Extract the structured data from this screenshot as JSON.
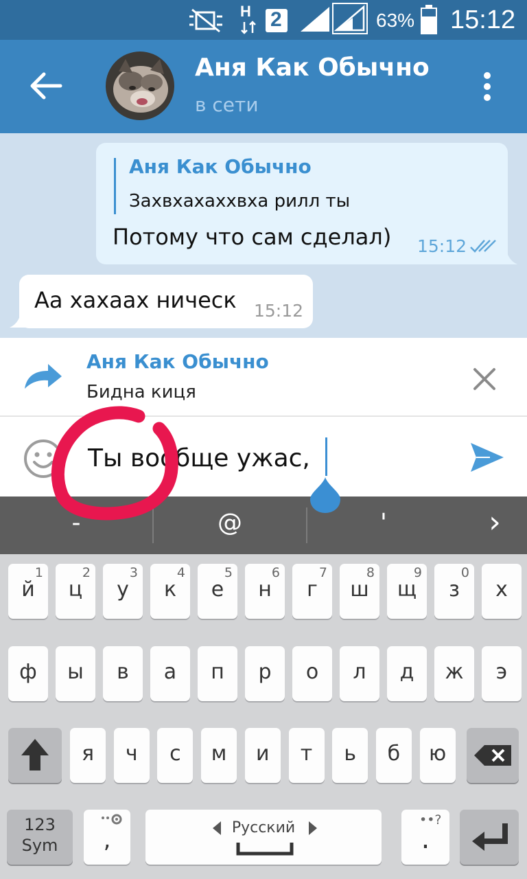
{
  "status_bar": {
    "network_h": "H",
    "sim_slot": "2",
    "battery_percent": "63%",
    "time": "15:12",
    "icons": [
      "mute-vibrate-icon",
      "data-arrows-icon",
      "signal-icon",
      "signal-icon-2",
      "battery-icon"
    ]
  },
  "header": {
    "contact_name": "Аня Как Обычно",
    "status": "в сети",
    "icons": [
      "back-arrow-icon",
      "avatar",
      "more-vert-icon"
    ]
  },
  "messages": [
    {
      "direction": "out",
      "reply_to_name": "Аня Как Обычно",
      "reply_to_text": "Захвхахаххвха рилл ты",
      "text": "Потому что сам сделал)",
      "time": "15:12",
      "read_icon": "double-check-icon"
    },
    {
      "direction": "in",
      "text": "Аа хахаах ническ",
      "time": "15:12"
    }
  ],
  "forward_panel": {
    "name": "Аня Как Обычно",
    "text": "Бидна киця",
    "icons": [
      "forward-arrow-icon",
      "close-icon"
    ]
  },
  "input": {
    "value": "Ты вообще ужас,",
    "icons": [
      "emoji-icon",
      "send-icon"
    ]
  },
  "suggestions": [
    "-",
    "@",
    "'",
    "›"
  ],
  "keyboard": {
    "row1": [
      {
        "label": "й",
        "hint": "1"
      },
      {
        "label": "ц",
        "hint": "2"
      },
      {
        "label": "у",
        "hint": "3"
      },
      {
        "label": "к",
        "hint": "4"
      },
      {
        "label": "е",
        "hint": "5"
      },
      {
        "label": "н",
        "hint": "6"
      },
      {
        "label": "г",
        "hint": "7"
      },
      {
        "label": "ш",
        "hint": "8"
      },
      {
        "label": "щ",
        "hint": "9"
      },
      {
        "label": "з",
        "hint": "0"
      },
      {
        "label": "х",
        "hint": ""
      }
    ],
    "row2": [
      "ф",
      "ы",
      "в",
      "а",
      "п",
      "р",
      "о",
      "л",
      "д",
      "ж",
      "э"
    ],
    "row3": [
      "я",
      "ч",
      "с",
      "м",
      "и",
      "т",
      "ь",
      "б",
      "ю"
    ],
    "sym_label_1": "123",
    "sym_label_2": "Sym",
    "comma": ",",
    "language": "Русский",
    "period": ".",
    "icons": [
      "shift-icon",
      "backspace-icon",
      "settings-icon",
      "space-icon",
      "enter-icon"
    ]
  },
  "colors": {
    "header": "#3a85c0",
    "status_bar": "#2f6d9e",
    "accent": "#3a8fd0",
    "chat_bg": "#cfdfee",
    "outgoing_bubble": "#e4f3fd",
    "annotation": "#e8174f"
  }
}
